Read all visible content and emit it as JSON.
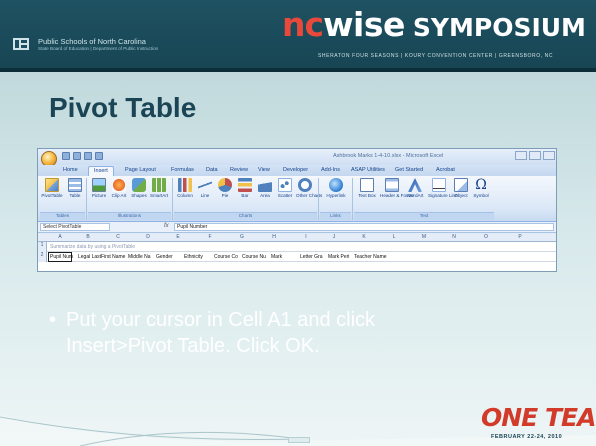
{
  "header": {
    "agency_line1": "Public Schools of North Carolina",
    "agency_line2": "State Board of Education | Department of Public Instruction",
    "brand_nc": "nc",
    "brand_wise": "wise",
    "brand_symposium": "SYMPOSIUM",
    "venue": "SHERATON FOUR SEASONS  |  KOURY CONVENTION CENTER  |  GREENSBORO, NC"
  },
  "slide": {
    "title": "Pivot Table",
    "bullet_marker": "•",
    "bullet_line1": "Put your cursor in Cell A1 and click",
    "bullet_line2": "Insert>Pivot Table.  Click OK."
  },
  "excel": {
    "window_title": "Ashbrook Marks 1-4-10.xlsx - Microsoft Excel",
    "tabs": [
      "Home",
      "Insert",
      "Page Layout",
      "Formulas",
      "Data",
      "Review",
      "View",
      "Developer",
      "Add-Ins",
      "ASAP Utilities",
      "Get Started",
      "Acrobat"
    ],
    "active_tab": "Insert",
    "ribbon_buttons": [
      "PivotTable",
      "Table",
      "Picture",
      "Clip Art",
      "Shapes",
      "SmartArt",
      "Column",
      "Line",
      "Pie",
      "Bar",
      "Area",
      "Scatter",
      "Other Charts",
      "Hyperlink",
      "Text Box",
      "Header & Footer",
      "WordArt",
      "Signature Line",
      "Object",
      "Symbol"
    ],
    "groups": [
      "Tables",
      "Illustrations",
      "Charts",
      "Links",
      "Text"
    ],
    "name_box": "Select PivotTable",
    "fx": "fx",
    "formula_value": "Pupil Number",
    "columns": [
      "A",
      "B",
      "C",
      "D",
      "E",
      "F",
      "G",
      "H",
      "I",
      "J",
      "K",
      "L",
      "M",
      "N",
      "O",
      "P"
    ],
    "row1_faded": "Summarize data by using a PivotTable",
    "row2_cells": [
      "Pupil Num",
      "Legal Last",
      "First Name",
      "Middle Na",
      "Gender",
      "Ethnicity",
      "Course Co",
      "Course Nu",
      "Mark",
      "Letter Gra",
      "Mark Peri",
      "Teacher Name"
    ],
    "row_numbers": [
      "1",
      "2"
    ]
  },
  "footer": {
    "logo_text": "ONE TEAM",
    "date": "FEBRUARY 22-24, 2010"
  },
  "colors": {
    "header_bg": "#1d4e5e",
    "brand_red": "#e8493a",
    "title": "#1b4555",
    "bullet_text": "#ffffff"
  }
}
